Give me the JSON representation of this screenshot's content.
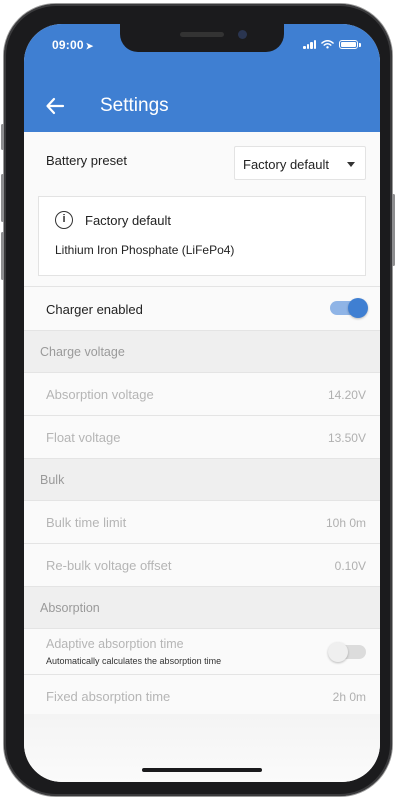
{
  "status_bar": {
    "time": "09:00"
  },
  "header": {
    "title": "Settings"
  },
  "battery_preset": {
    "label": "Battery preset",
    "selected": "Factory default"
  },
  "info": {
    "title": "Factory default",
    "text": "Lithium Iron Phosphate (LiFePo4)"
  },
  "charger_enabled": {
    "label": "Charger enabled",
    "on": true
  },
  "charge_voltage": {
    "title": "Charge voltage",
    "rows": [
      {
        "label": "Absorption voltage",
        "value": "14.20V"
      },
      {
        "label": "Float voltage",
        "value": "13.50V"
      }
    ]
  },
  "bulk": {
    "title": "Bulk",
    "rows": [
      {
        "label": "Bulk time limit",
        "value": "10h 0m"
      },
      {
        "label": "Re-bulk voltage offset",
        "value": "0.10V"
      }
    ]
  },
  "absorption": {
    "title": "Absorption",
    "adaptive": {
      "label": "Adaptive absorption time",
      "sublabel": "Automatically calculates the absorption time",
      "on": false
    },
    "fixed": {
      "label": "Fixed absorption time",
      "value": "2h 0m"
    }
  },
  "colors": {
    "accent": "#3f7fd2",
    "toggle_track_on": "#8fb4e6"
  }
}
